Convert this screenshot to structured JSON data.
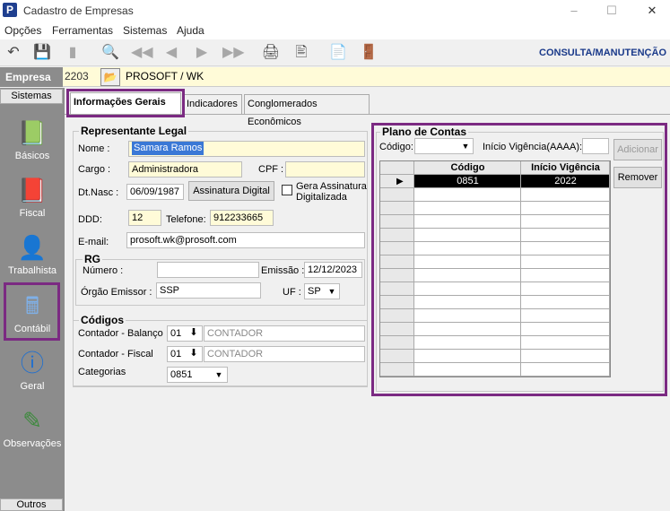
{
  "window": {
    "title": "Cadastro de Empresas",
    "icon_letter": "P"
  },
  "menu": [
    "Opções",
    "Ferramentas",
    "Sistemas",
    "Ajuda"
  ],
  "toolbar": {
    "mode_label": "CONSULTA/MANUTENÇÃO",
    "icons": [
      "undo-icon",
      "save-icon",
      "bookmark-icon",
      "preview-icon",
      "first-icon",
      "prev-icon",
      "next-icon",
      "last-icon",
      "print-icon",
      "calc-icon",
      "export-icon",
      "exit-icon"
    ]
  },
  "empresa": {
    "label": "Empresa",
    "code": "2203",
    "name": "PROSOFT / WK"
  },
  "sidebar": {
    "header": "Sistemas",
    "footer": "Outros",
    "items": [
      {
        "label": "Básicos",
        "icon": "book-icon"
      },
      {
        "label": "Fiscal",
        "icon": "fiscal-book-icon"
      },
      {
        "label": "Trabalhista",
        "icon": "worker-icon"
      },
      {
        "label": "Contábil",
        "icon": "calculator-icon"
      },
      {
        "label": "Geral",
        "icon": "info-icon"
      },
      {
        "label": "Observações",
        "icon": "notes-icon"
      }
    ]
  },
  "tabs": [
    "Informações Gerais",
    "Indicadores",
    "Conglomerados Econômicos"
  ],
  "representante": {
    "title": "Representante Legal",
    "nome_label": "Nome :",
    "nome": "Samara Ramos",
    "cargo_label": "Cargo :",
    "cargo": "Administradora",
    "cpf_label": "CPF :",
    "cpf": "",
    "dtnasc_label": "Dt.Nasc :",
    "dtnasc": "06/09/1987",
    "assinatura_button": "Assinatura Digital",
    "gera_assinatura_line1": "Gera Assinatura",
    "gera_assinatura_line2": "Digitalizada",
    "ddd_label": "DDD:",
    "ddd": "12",
    "telefone_label": "Telefone:",
    "telefone": "912233665",
    "email_label": "E-mail:",
    "email": "prosoft.wk@prosoft.com"
  },
  "rg": {
    "title": "RG",
    "numero_label": "Número :",
    "numero": "",
    "emissao_label": "Emissão :",
    "emissao": "12/12/2023",
    "orgao_label": "Órgão Emissor :",
    "orgao": "SSP",
    "uf_label": "UF :",
    "uf": "SP"
  },
  "codigos": {
    "title": "Códigos",
    "balanco_label": "Contador - Balanço",
    "balanco_code": "01",
    "balanco_name": "CONTADOR",
    "fiscal_label": "Contador - Fiscal",
    "fiscal_code": "01",
    "fiscal_name": "CONTADOR",
    "categorias_label": "Categorias",
    "categorias": "0851"
  },
  "plano": {
    "title": "Plano de Contas",
    "codigo_label": "Código:",
    "codigo": "",
    "vigencia_label": "Início Vigência(AAAA):",
    "vigencia": "",
    "adicionar_button": "Adicionar",
    "remover_button": "Remover",
    "columns": [
      "Código",
      "Início Vigência"
    ],
    "rows": [
      {
        "codigo": "0851",
        "vigencia": "2022"
      }
    ]
  }
}
